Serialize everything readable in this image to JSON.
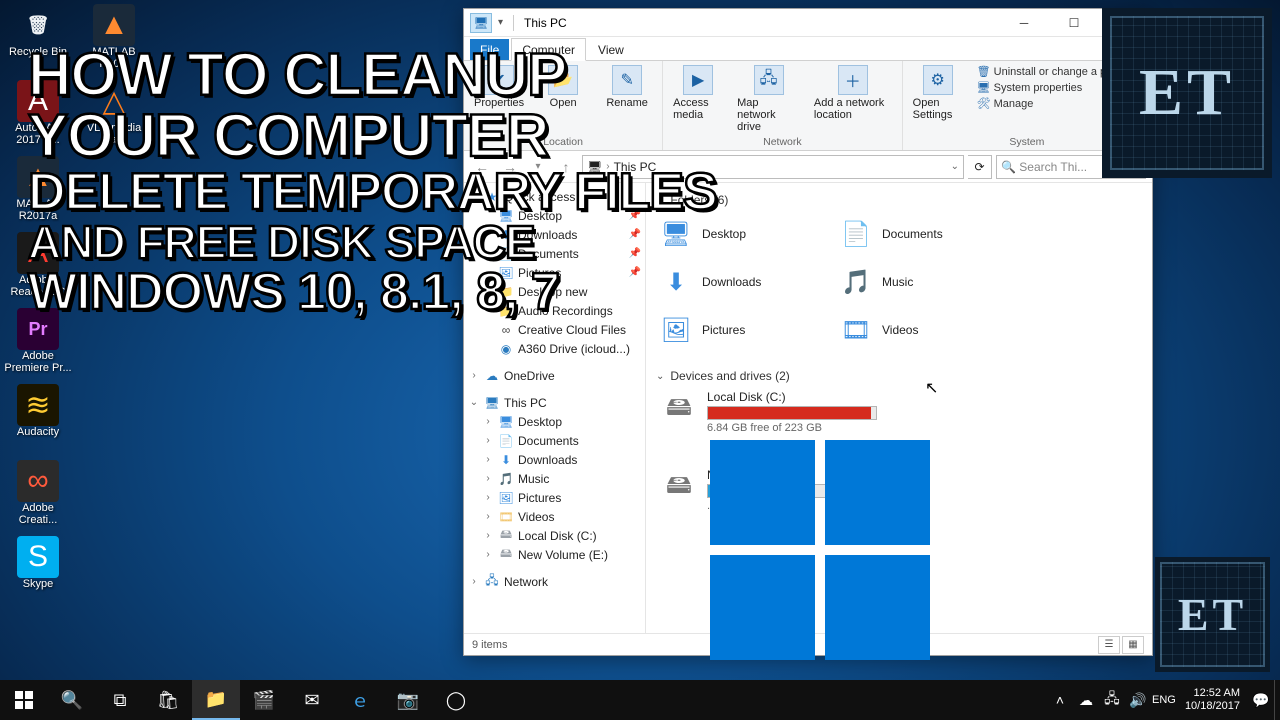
{
  "desktop": {
    "col1": [
      {
        "label": "Recycle Bin",
        "glyph": "🗑",
        "bg": "",
        "fg": "#eef2f5"
      },
      {
        "label": "AutoCAD 2017 - ...",
        "glyph": "A",
        "bg": "#7a1418",
        "fg": "#fff"
      },
      {
        "label": "MATLAB R2017a",
        "glyph": "▲",
        "bg": "#1a2a3a",
        "fg": "#ff8a30"
      },
      {
        "label": "Acrobat Reader DC",
        "glyph": "A",
        "bg": "#1a1a1a",
        "fg": "#ff3b30"
      },
      {
        "label": "Adobe Premiere Pr...",
        "glyph": "Pr",
        "bg": "#2a0033",
        "fg": "#e37cff"
      },
      {
        "label": "Audacity",
        "glyph": "≋",
        "bg": "#1a1500",
        "fg": "#ffcc33"
      },
      {
        "label": "Adobe Creati...",
        "glyph": "∞",
        "bg": "#2b2b2b",
        "fg": "#ff5a3c"
      },
      {
        "label": "Skype",
        "glyph": "S",
        "bg": "#00aff0",
        "fg": "#fff"
      }
    ],
    "col2": [
      {
        "label": "MATLAB R20...",
        "glyph": "▲",
        "bg": "#1a2a3a",
        "fg": "#ff8a30"
      },
      {
        "label": "VLC media pla...",
        "glyph": "△",
        "bg": "",
        "fg": "#ff7d1a"
      }
    ]
  },
  "overlay": {
    "l1": "HOW TO CLEANUP",
    "l2": "YOUR COMPUTER",
    "l3": "DELETE TEMPORARY FILES",
    "l4": "AND FREE DISK SPACE",
    "l5": "WINDOWS 10, 8.1, 8, 7"
  },
  "badge": "ET",
  "explorer": {
    "title": "This PC",
    "tabs": {
      "file": "File",
      "computer": "Computer",
      "view": "View"
    },
    "ribbon": {
      "location": {
        "group": "Location",
        "properties": "Properties",
        "open": "Open",
        "rename": "Rename"
      },
      "network": {
        "group": "Network",
        "media": "Access media",
        "map": "Map network drive",
        "add": "Add a network location"
      },
      "system": {
        "group": "System",
        "settings": "Open Settings",
        "uninstall": "Uninstall or change a program",
        "sysprops": "System properties",
        "manage": "Manage"
      }
    },
    "addr": {
      "thispc": "This PC",
      "search": "Search Thi..."
    },
    "nav": {
      "quick": "Quick access",
      "desktop": "Desktop",
      "downloads": "Downloads",
      "documents": "Documents",
      "pictures": "Pictures",
      "desktopnew": "Desktop new",
      "audrec": "Audio Recordings",
      "ccf": "Creative Cloud Files",
      "a360": "A360 Drive (icloud...)",
      "onedrive": "OneDrive",
      "thispc": "This PC",
      "music": "Music",
      "videos": "Videos",
      "localc": "Local Disk (C:)",
      "vole": "New Volume (E:)",
      "network": "Network"
    },
    "content": {
      "foldersHeader": "Folders (6)",
      "drivesHeader": "Devices and drives (2)",
      "folders": [
        {
          "n": "Desktop",
          "ic": "🖥",
          "c": "#3a8dde"
        },
        {
          "n": "Documents",
          "ic": "📄",
          "c": "#3a8dde"
        },
        {
          "n": "Downloads",
          "ic": "⬇",
          "c": "#3a8dde"
        },
        {
          "n": "Music",
          "ic": "🎵",
          "c": "#3a8dde"
        },
        {
          "n": "Pictures",
          "ic": "🖼",
          "c": "#3a8dde"
        },
        {
          "n": "Videos",
          "ic": "🎞",
          "c": "#3a8dde"
        }
      ],
      "drives": [
        {
          "n": "Local Disk (C:)",
          "sub": "6.84 GB free of 223 GB",
          "pct": 97,
          "color": "#d52b1e"
        },
        {
          "n": "New Volume (E:)",
          "sub": "... GB free of ...",
          "pct": 48,
          "color": "#26a0da"
        }
      ]
    },
    "status": "9 items"
  },
  "taskbar": {
    "time": "12:52 AM",
    "date": "10/18/2017"
  }
}
